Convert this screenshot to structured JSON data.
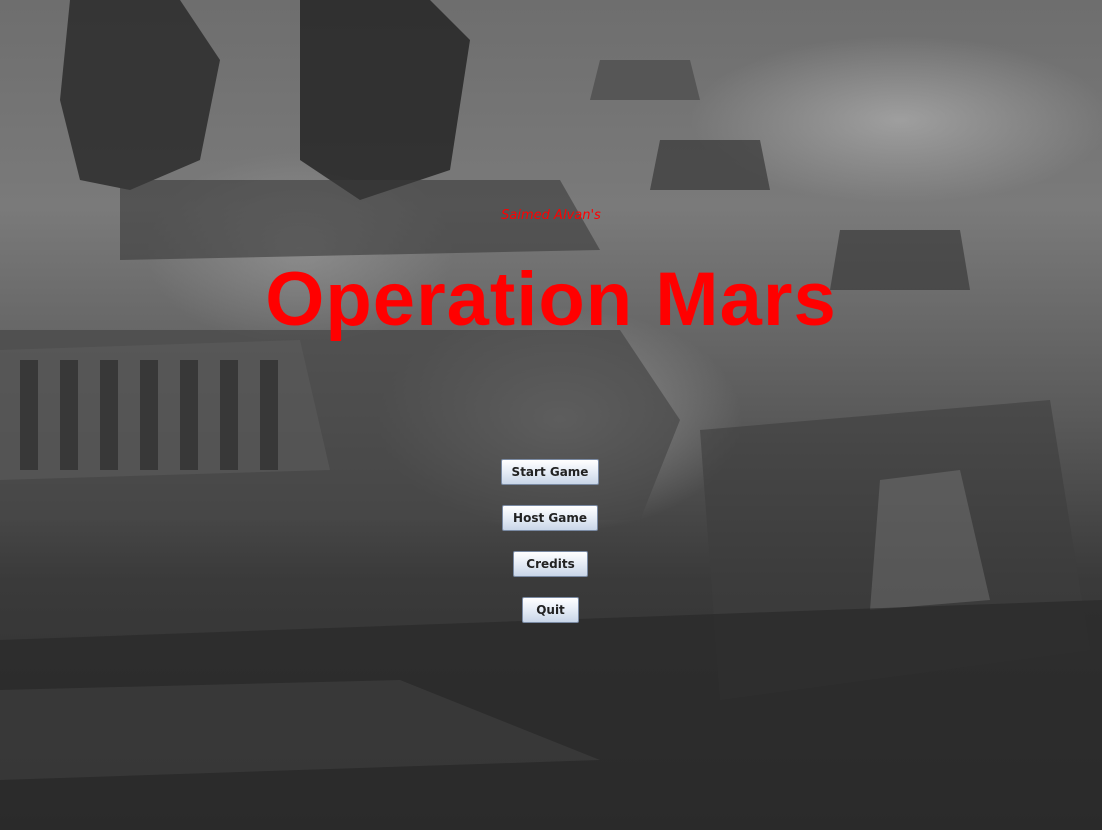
{
  "subtitle": "Saimed Alvan's",
  "title": "Operation Mars",
  "menu": {
    "start_label": "Start Game",
    "host_label": "Host Game",
    "credits_label": "Credits",
    "quit_label": "Quit"
  },
  "colors": {
    "title": "#ff0000",
    "button_top": "#ffffff",
    "button_bottom": "#c9d6e8"
  }
}
